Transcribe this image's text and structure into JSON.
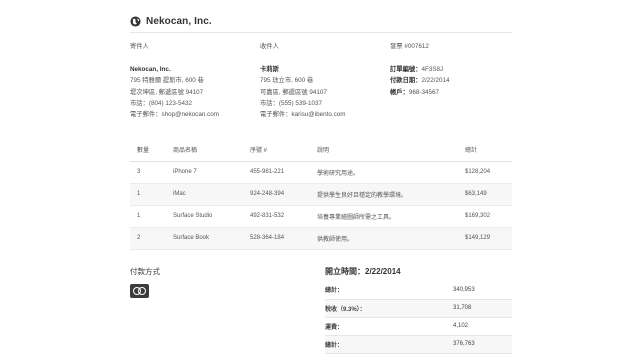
{
  "header": {
    "company": "Nekocan, Inc."
  },
  "from": {
    "heading": "寄件人",
    "name": "Nekocan, Inc.",
    "address1": "795 特雅爾 提斯市, 600 巷",
    "address2": "堤次坤區, 郵遞區號 94107",
    "phone": "市話：(804) 123-5432",
    "email": "電子郵件：shop@nekocan.com"
  },
  "to": {
    "heading": "收件人",
    "name": "卡莉斯",
    "address1": "795 琺立市, 600 巷",
    "address2": "可嘉區, 郵遞區號 94107",
    "phone": "市話：(555) 539-1037",
    "email": "電子郵件：karisu@ibento.com"
  },
  "invoice": {
    "heading": "發票 #007612",
    "order_label": "訂單編號：",
    "order_value": "4F3S8J",
    "due_label": "付款日期：",
    "due_value": "2/22/2014",
    "account_label": "帳戶：",
    "account_value": "968-34567"
  },
  "items": {
    "columns": [
      "數量",
      "商品名稱",
      "序號 #",
      "說明",
      "總計"
    ],
    "rows": [
      {
        "qty": "3",
        "name": "iPhone 7",
        "serial": "455-981-221",
        "desc": "學術研究用途。",
        "total": "$128,204"
      },
      {
        "qty": "1",
        "name": "iMac",
        "serial": "924-248-394",
        "desc": "提供學生良好且穩定的教學環境。",
        "total": "$63,149"
      },
      {
        "qty": "1",
        "name": "Surface Studio",
        "serial": "492-831-532",
        "desc": "培養專業繪圖師所需之工具。",
        "total": "$169,302"
      },
      {
        "qty": "2",
        "name": "Surface Book",
        "serial": "528-364-184",
        "desc": "供教師使用。",
        "total": "$149,129"
      }
    ]
  },
  "payment": {
    "title": "付款方式",
    "card_icon": "mastercard-icon"
  },
  "summary": {
    "issued": "開立時間：2/22/2014",
    "rows": [
      {
        "label": "總計：",
        "value": "340,953"
      },
      {
        "label": "稅收（9.3%）：",
        "value": "31,708"
      },
      {
        "label": "運費：",
        "value": "4,102"
      },
      {
        "label": "總計：",
        "value": "376,763"
      }
    ]
  }
}
